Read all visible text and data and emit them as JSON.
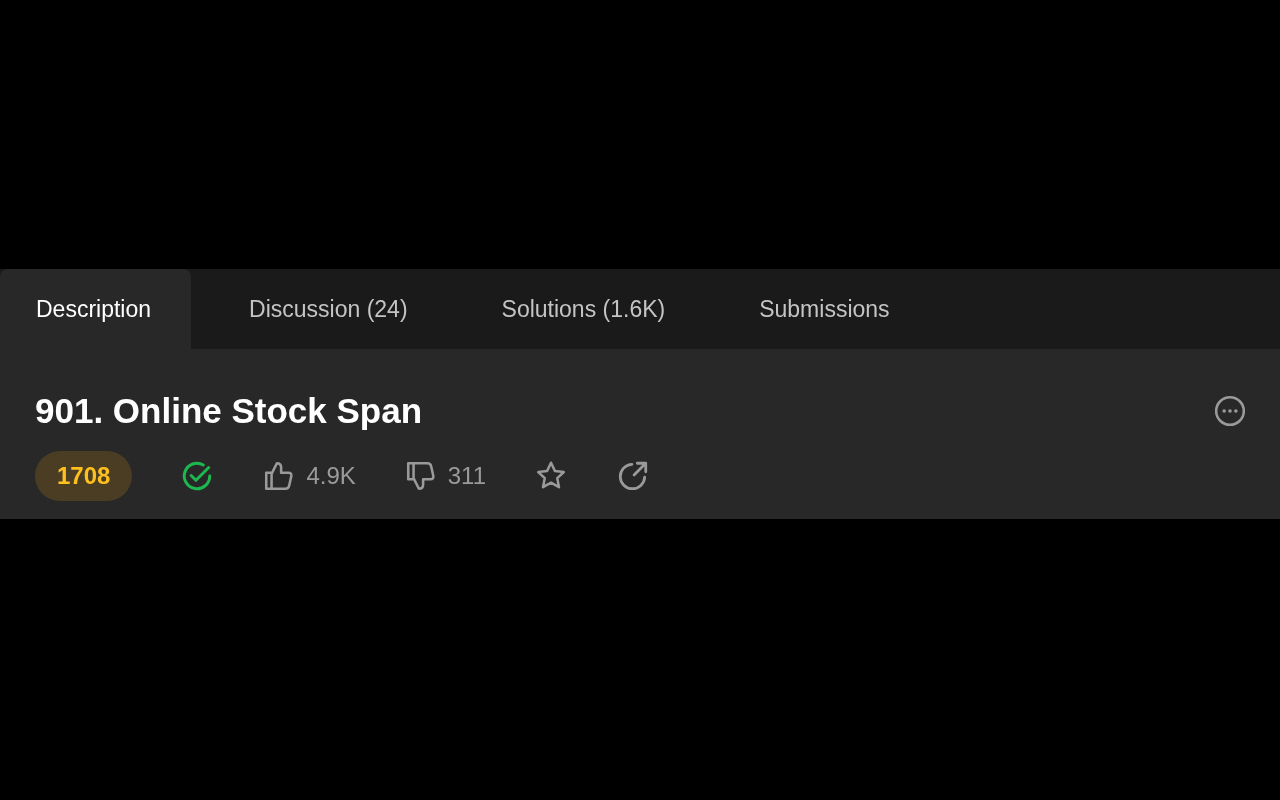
{
  "tabs": [
    {
      "label": "Description",
      "selected": true
    },
    {
      "label": "Discussion (24)",
      "selected": false
    },
    {
      "label": "Solutions (1.6K)",
      "selected": false
    },
    {
      "label": "Submissions",
      "selected": false
    }
  ],
  "problem": {
    "title": "901. Online Stock Span",
    "rating": "1708",
    "solved": true,
    "likes": "4.9K",
    "dislikes": "311",
    "favorited": false
  }
}
